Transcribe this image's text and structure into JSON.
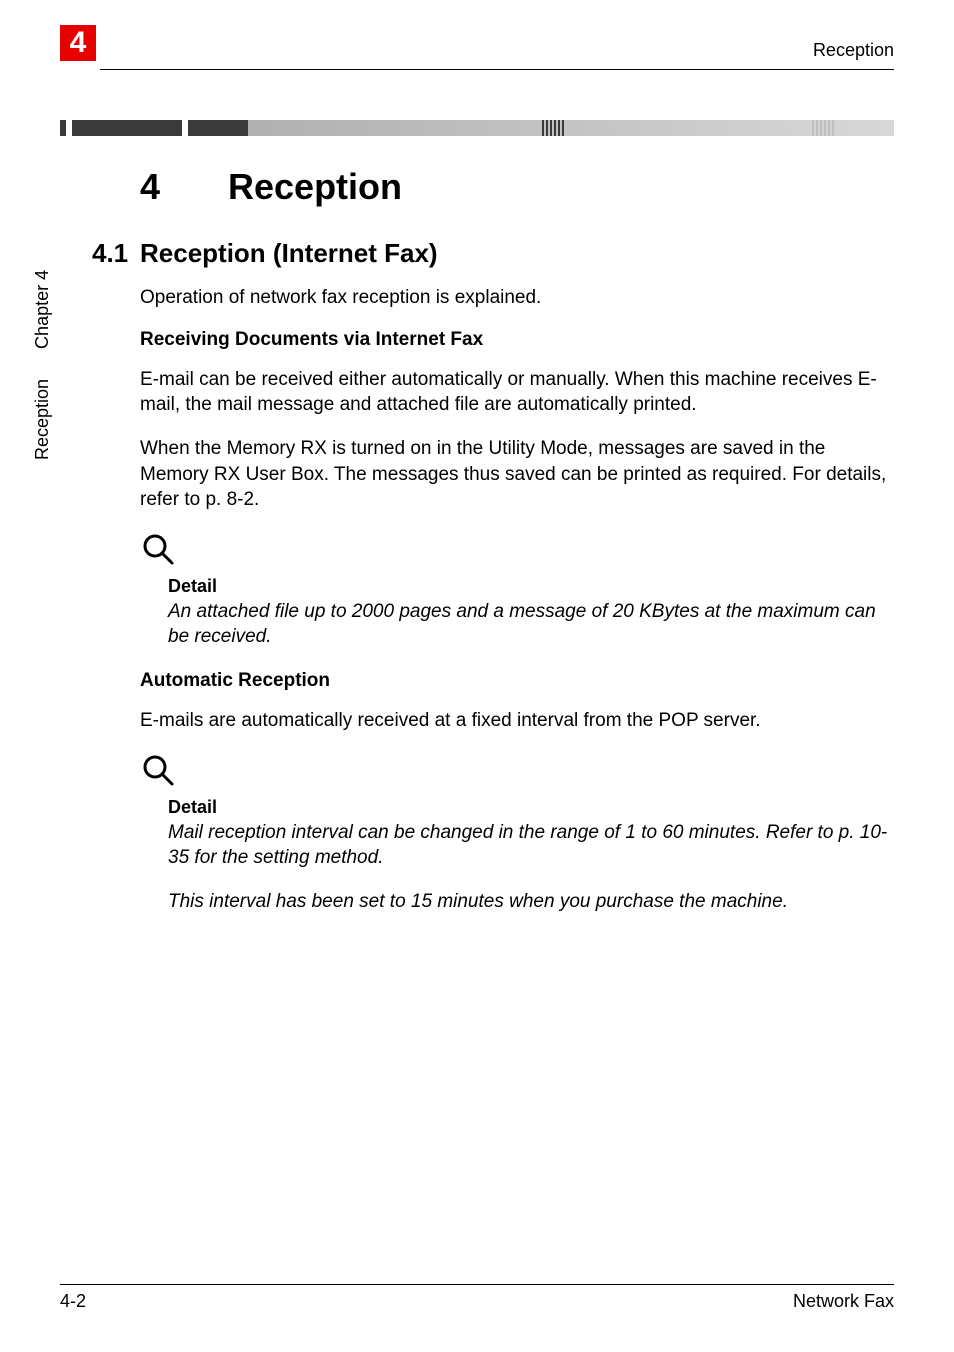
{
  "header": {
    "chapter_number": "4",
    "right_label": "Reception"
  },
  "side_tab": {
    "chapter_label": "Chapter 4",
    "section_label": "Reception"
  },
  "chapter": {
    "number": "4",
    "title": "Reception"
  },
  "section": {
    "number": "4.1",
    "title": "Reception (Internet Fax)",
    "intro": "Operation of network fax reception is explained."
  },
  "sub1": {
    "heading": "Receiving Documents via Internet Fax",
    "p1": "E-mail can be received either automatically or manually. When this machine receives E-mail, the mail message and attached file are automatically printed.",
    "p2": "When the Memory RX is turned on in the Utility Mode, messages are saved in the Memory RX User Box. The messages thus saved can be printed as required. For details, refer to p. 8-2."
  },
  "detail1": {
    "label": "Detail",
    "text": "An attached file up to 2000 pages and a message of 20 KBytes at the maximum can be received."
  },
  "sub2": {
    "heading": "Automatic Reception",
    "p1": "E-mails are automatically received at a fixed interval from the POP server."
  },
  "detail2": {
    "label": "Detail",
    "text1": "Mail reception interval can be changed in the range of 1 to 60 minutes. Refer to p. 10-35 for the setting method.",
    "text2": "This interval has been set to 15 minutes when you purchase the machine."
  },
  "footer": {
    "page": "4-2",
    "doc": "Network Fax"
  }
}
